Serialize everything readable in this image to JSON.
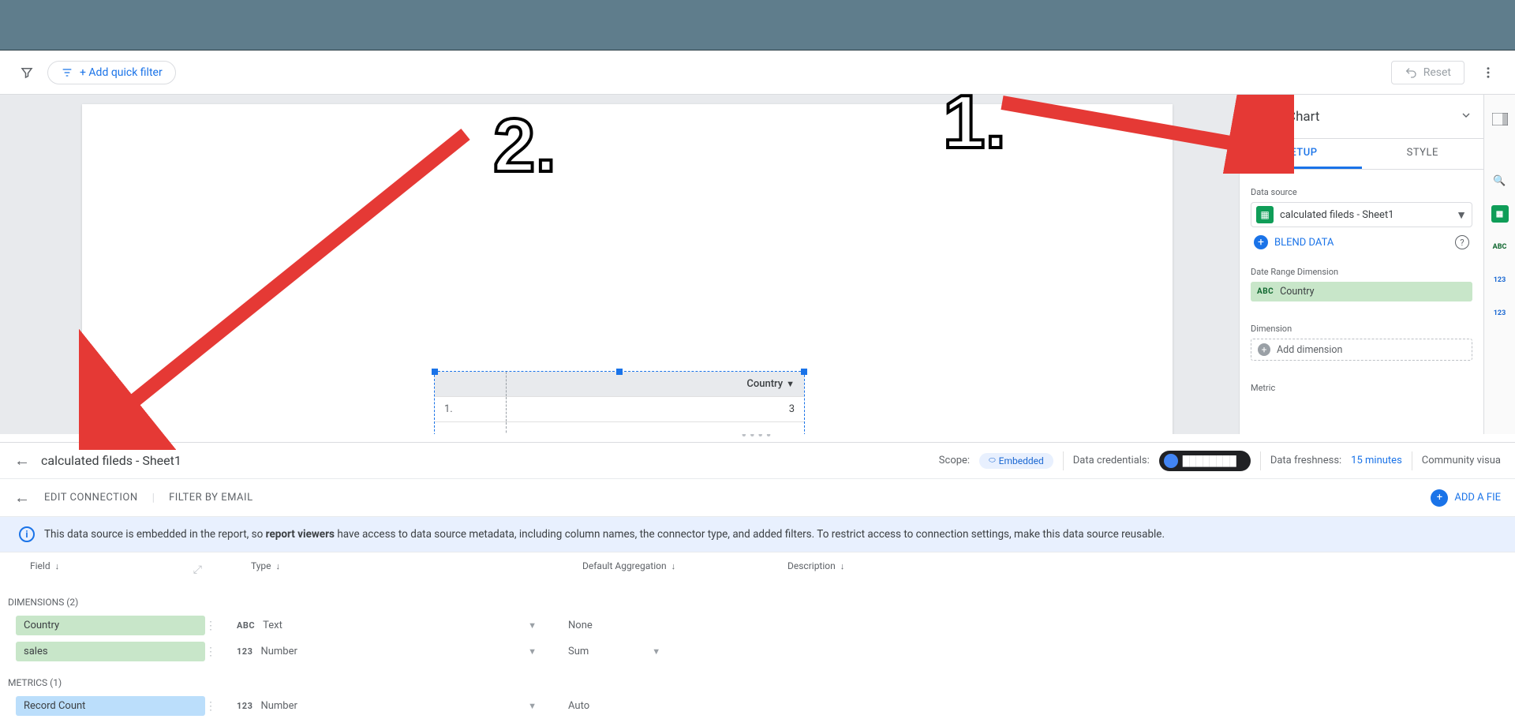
{
  "filterbar": {
    "quick_filter_label": "+ Add quick filter",
    "reset_label": "Reset"
  },
  "chart_table": {
    "header": "Country",
    "row_index": "1.",
    "row_value": "3"
  },
  "props": {
    "title": "Chart",
    "tabs": {
      "setup": "SETUP",
      "style": "STYLE"
    },
    "data_source_label": "Data source",
    "data_source_name": "calculated fileds - Sheet1",
    "blend_label": "BLEND DATA",
    "date_range_label": "Date Range Dimension",
    "date_range_field": "Country",
    "dimension_label": "Dimension",
    "add_dimension": "Add dimension",
    "metric_label": "Metric"
  },
  "ds_pane": {
    "title": "calculated fileds - Sheet1",
    "scope_label": "Scope:",
    "scope_value": "Embedded",
    "credentials_label": "Data credentials:",
    "freshness_label": "Data freshness:",
    "freshness_value": "15 minutes",
    "community_label": "Community visua",
    "edit_connection": "EDIT CONNECTION",
    "filter_by_email": "FILTER BY EMAIL",
    "add_field": "ADD A FIE",
    "info_banner_pre": "This data source is embedded in the report, so ",
    "info_banner_bold": "report viewers",
    "info_banner_post": " have access to data source metadata, including column names, the connector type, and added filters. To restrict access to connection settings, make this data source reusable.",
    "columns": {
      "field": "Field",
      "type": "Type",
      "agg": "Default Aggregation",
      "desc": "Description"
    },
    "groups": {
      "dimensions": "DIMENSIONS (2)",
      "metrics": "METRICS (1)"
    },
    "fields": {
      "country": {
        "name": "Country",
        "type_icon": "ABC",
        "type": "Text",
        "agg": "None"
      },
      "sales": {
        "name": "sales",
        "type_icon": "123",
        "type": "Number",
        "agg": "Sum"
      },
      "record_count": {
        "name": "Record Count",
        "type_icon": "123",
        "type": "Number",
        "agg": "Auto"
      }
    }
  },
  "annotations": {
    "one": "1.",
    "two": "2."
  },
  "rail_labels": {
    "abc": "ABC",
    "n1": "123",
    "n2": "123"
  }
}
